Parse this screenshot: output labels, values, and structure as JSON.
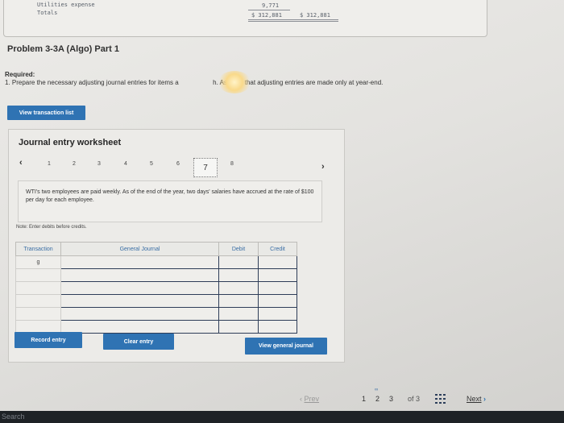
{
  "statement": {
    "line1": "Utilities expense",
    "line2": "Totals",
    "val_top": "9,771",
    "val_total_left": "$ 312,881",
    "val_total_right": "$ 312,881"
  },
  "problem": {
    "title": "Problem 3-3A (Algo) Part 1",
    "required_label": "Required:",
    "required_text_a": "1. Prepare the necessary adjusting journal entries for items a",
    "required_text_b": "h. Assume that adjusting entries are made only at year-end."
  },
  "buttons": {
    "view_transactions": "View transaction list",
    "record_entry": "Record entry",
    "clear_entry": "Clear entry",
    "view_general_journal": "View general journal"
  },
  "worksheet": {
    "title": "Journal entry worksheet",
    "tabs": [
      "1",
      "2",
      "3",
      "4",
      "5",
      "6",
      "7",
      "8"
    ],
    "active_tab": "7",
    "description": "WTI's two employees are paid weekly. As of the end of the year, two days' salaries have accrued at the rate of $100 per day for each employee.",
    "note": "Note: Enter debits before credits.",
    "columns": [
      "Transaction",
      "General Journal",
      "Debit",
      "Credit"
    ],
    "transaction_value": "g"
  },
  "pagination": {
    "prev": "Prev",
    "pages": [
      "1",
      "2",
      "3"
    ],
    "current": "2",
    "of_label": "of 3",
    "next": "Next"
  },
  "taskbar": {
    "search": "Search"
  }
}
